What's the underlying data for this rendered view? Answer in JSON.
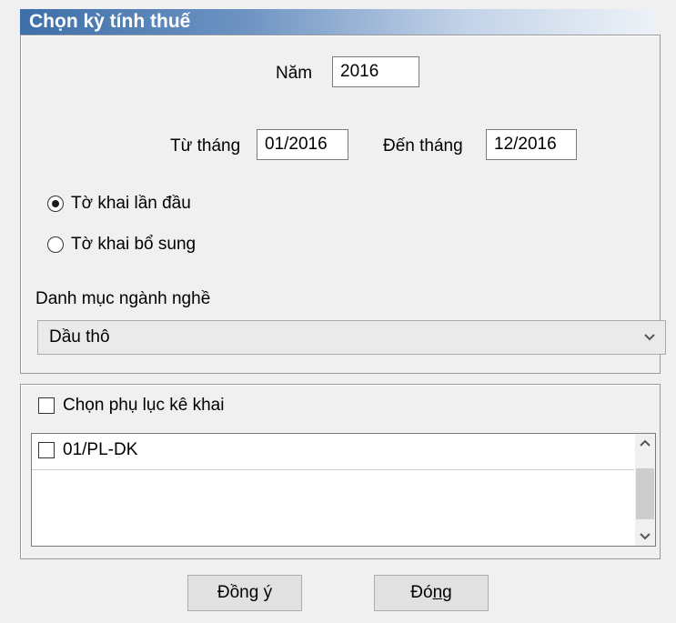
{
  "title": "Chọn kỳ tính thuế",
  "period": {
    "year_label": "Năm",
    "year_value": "2016",
    "from_label": "Từ tháng",
    "from_value": "01/2016",
    "to_label": "Đến tháng",
    "to_value": "12/2016"
  },
  "declaration_type": {
    "options": [
      {
        "label": "Tờ khai lần đầu",
        "selected": true
      },
      {
        "label": "Tờ khai bổ sung",
        "selected": false
      }
    ]
  },
  "industry": {
    "label": "Danh mục ngành nghề",
    "selected": "Dầu thô"
  },
  "appendix": {
    "select_all_label": "Chọn phụ lục kê khai",
    "select_all_checked": false,
    "items": [
      {
        "label": "01/PL-DK",
        "checked": false
      }
    ]
  },
  "buttons": {
    "ok": {
      "pre": "Đồn",
      "mnemonic": "g",
      "post": " ý"
    },
    "close": {
      "pre": "Đó",
      "mnemonic": "n",
      "post": "g"
    }
  },
  "icons": {
    "combo_arrow": "chevron-down-icon",
    "scroll_up": "chevron-up-icon",
    "scroll_down": "chevron-down-icon"
  }
}
